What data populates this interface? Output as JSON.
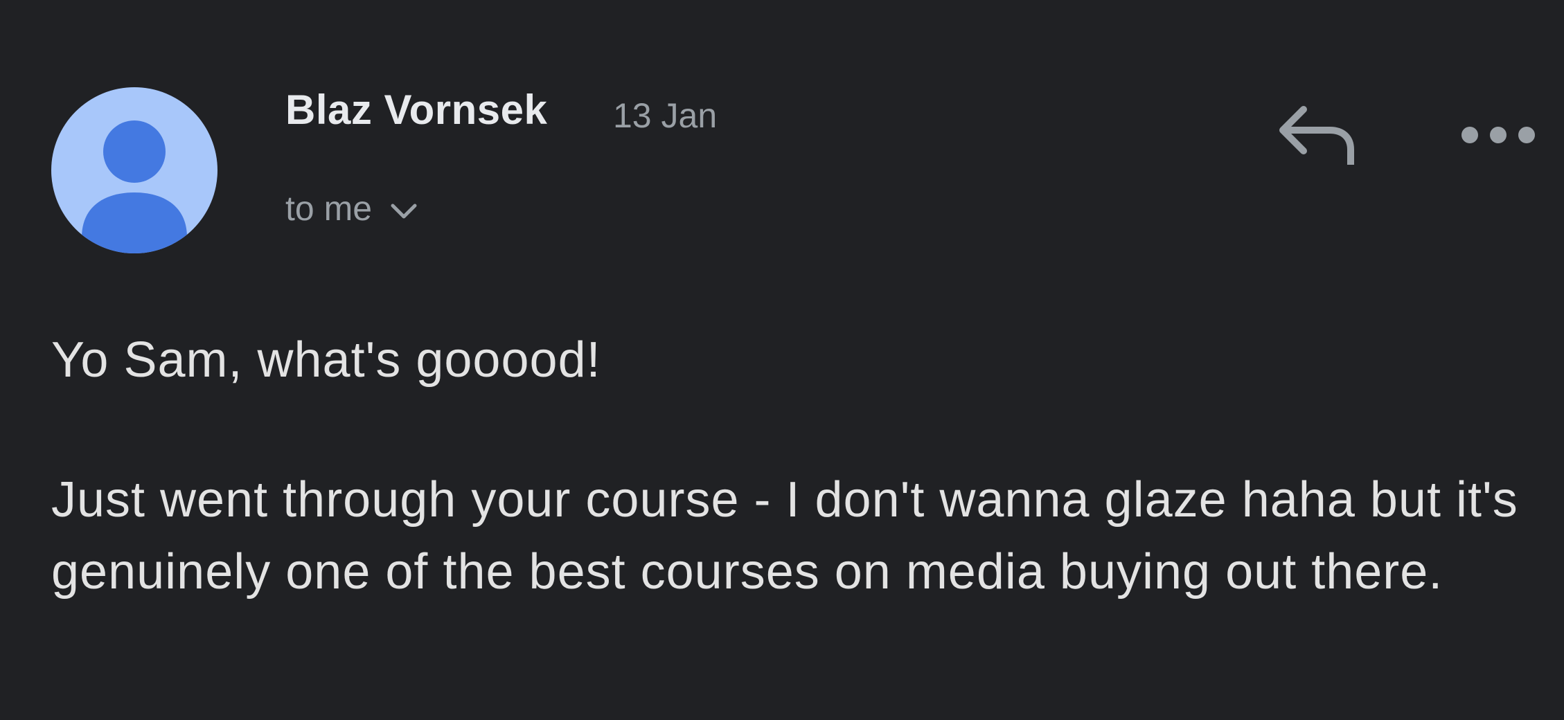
{
  "message": {
    "sender_name": "Blaz Vornsek",
    "date": "13 Jan",
    "recipients_label": "to me",
    "body_paragraphs": [
      "Yo Sam, what's gooood!",
      "Just went through your course - I don't wanna glaze haha but it's genuinely one of the best courses on media buying out there."
    ]
  },
  "icons": {
    "avatar": "person-avatar-icon",
    "recipients_toggle": "chevron-down-icon",
    "reply": "reply-icon",
    "more": "more-horizontal-icon"
  },
  "colors": {
    "background": "#202124",
    "avatar_bg": "#a8c7fa",
    "avatar_figure": "#4479e1",
    "primary_text": "#e8eaed",
    "secondary_text": "#9aa0a6"
  }
}
